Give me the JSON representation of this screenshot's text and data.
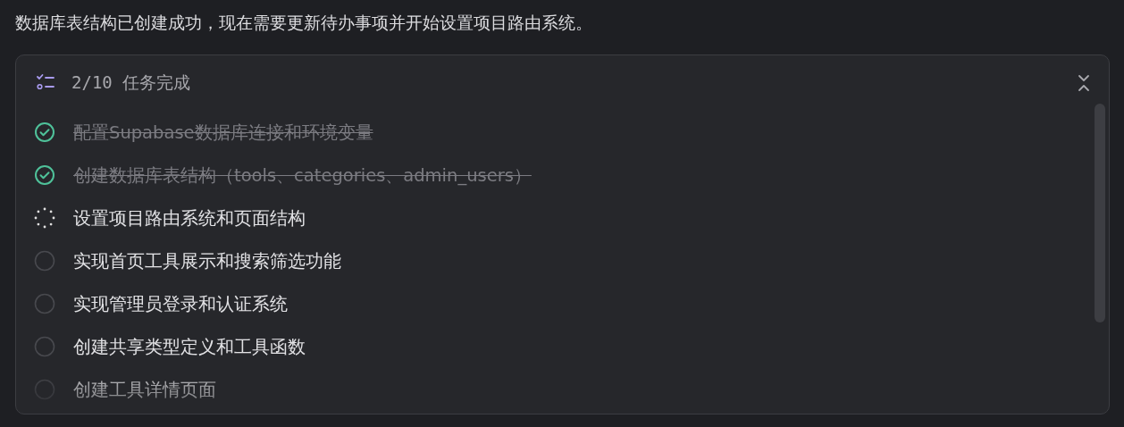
{
  "message": "数据库表结构已创建成功，现在需要更新待办事项并开始设置项目路由系统。",
  "todo_panel": {
    "summary": "2/10 任务完成",
    "expanded": true,
    "tasks": [
      {
        "text": "配置Supabase数据库连接和环境变量",
        "kind": "done"
      },
      {
        "text": "创建数据库表结构（tools、categories、admin_users）",
        "kind": "done"
      },
      {
        "text": "设置项目路由系统和页面结构",
        "kind": "active"
      },
      {
        "text": "实现首页工具展示和搜索筛选功能",
        "kind": "pending"
      },
      {
        "text": "实现管理员登录和认证系统",
        "kind": "pending"
      },
      {
        "text": "创建共享类型定义和工具函数",
        "kind": "pending"
      },
      {
        "text": "创建工具详情页面",
        "kind": "pending"
      }
    ]
  }
}
